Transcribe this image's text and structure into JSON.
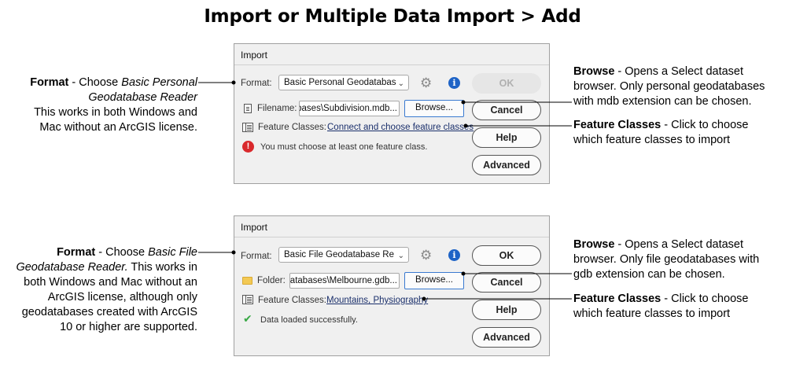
{
  "page": {
    "title": "Import or Multiple Data Import > Add"
  },
  "dialogs": [
    {
      "title": "Import",
      "format_label": "Format:",
      "format_value": "Basic Personal Geodatabas",
      "ok_label": "OK",
      "ok_enabled": false,
      "source_label": "Filename:",
      "source_value": "...atabases\\Subdivision.mdb",
      "browse_label": "Browse...",
      "cancel_label": "Cancel",
      "feature_classes_label": "Feature Classes:",
      "feature_classes_link": "Connect and choose feature classes",
      "help_label": "Help",
      "status_text": "You must choose at least one feature class.",
      "status_kind": "error",
      "advanced_label": "Advanced"
    },
    {
      "title": "Import",
      "format_label": "Format:",
      "format_value": "Basic File Geodatabase Re",
      "ok_label": "OK",
      "ok_enabled": true,
      "source_label": "Folder:",
      "source_value": "...eodatabases\\Melbourne.gdb",
      "browse_label": "Browse...",
      "cancel_label": "Cancel",
      "feature_classes_label": "Feature Classes:",
      "feature_classes_link": "Mountains, Physiography",
      "help_label": "Help",
      "status_text": "Data loaded successfully.",
      "status_kind": "success",
      "advanced_label": "Advanced"
    }
  ],
  "callouts": {
    "top_left": {
      "bold": "Format",
      "text1": " - Choose ",
      "italic": "Basic Personal Geodatabase Reader",
      "text2": "This works in both Windows and Mac without an ArcGIS license."
    },
    "top_right_browse": {
      "bold": "Browse",
      "text": " - Opens a Select dataset browser. Only personal geodatabases with mdb extension can be chosen."
    },
    "top_right_fc": {
      "bold": "Feature Classes",
      "text": " - Click to choose which feature classes to import"
    },
    "bottom_left": {
      "bold": "Format",
      "text1": " - Choose ",
      "italic": "Basic File Geodatabase Reader.",
      "text2": " This works in both Windows and Mac without an ArcGIS license, although only geodatabases created with ArcGIS 10 or higher are supported."
    },
    "bottom_right_browse": {
      "bold": "Browse",
      "text": " - Opens a Select dataset browser. Only file geodatabases with gdb extension can be chosen."
    },
    "bottom_right_fc": {
      "bold": "Feature Classes",
      "text": " - Click to choose which feature classes to import"
    }
  },
  "icons": {
    "settings": "gear-icon",
    "info": "info-icon",
    "error": "error-icon",
    "success": "check-icon",
    "file": "file-icon",
    "folder": "folder-icon",
    "feature_classes": "table-icon"
  },
  "colors": {
    "dialog_bg": "#f0f0f0",
    "error_red": "#d9292c",
    "info_blue": "#1e63c6",
    "success_green": "#38a845",
    "link": "#1a2f6b",
    "browse_border": "#3a7ad0"
  }
}
